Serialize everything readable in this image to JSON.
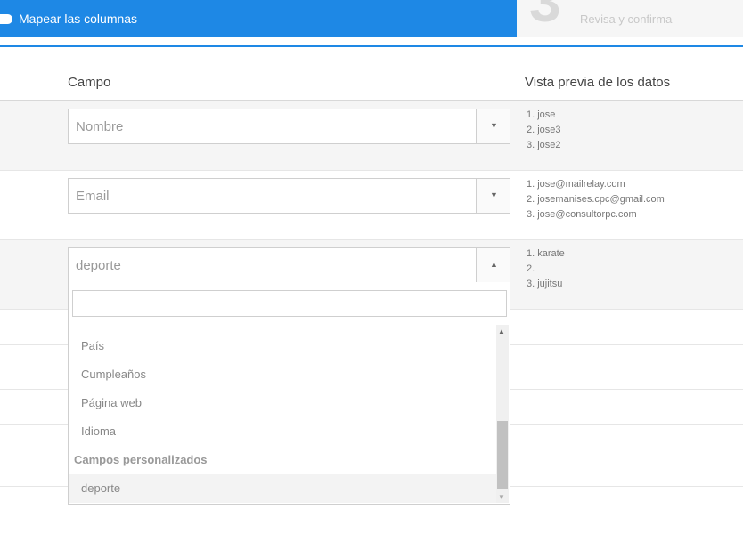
{
  "steps": {
    "active_label": "Mapear las columnas",
    "next_number": "3",
    "next_label": "Revisa y confirma"
  },
  "table": {
    "col_field": "Campo",
    "col_preview": "Vista previa de los datos"
  },
  "rows": [
    {
      "selected": "Nombre",
      "preview": [
        "1. jose",
        "2. jose3",
        "3. jose2"
      ]
    },
    {
      "selected": "Email",
      "preview": [
        "1. jose@mailrelay.com",
        "2. josemanises.cpc@gmail.com",
        "3. jose@consultorpc.com"
      ]
    },
    {
      "selected": "deporte",
      "preview": [
        "1. karate",
        "2.",
        "3. jujitsu"
      ]
    }
  ],
  "dropdown": {
    "search_value": "",
    "options": [
      "País",
      "Cumpleaños",
      "Página web",
      "Idioma"
    ],
    "group_label": "Campos personalizados",
    "selected_option": "deporte"
  },
  "colors": {
    "accent": "#1e88e5"
  }
}
